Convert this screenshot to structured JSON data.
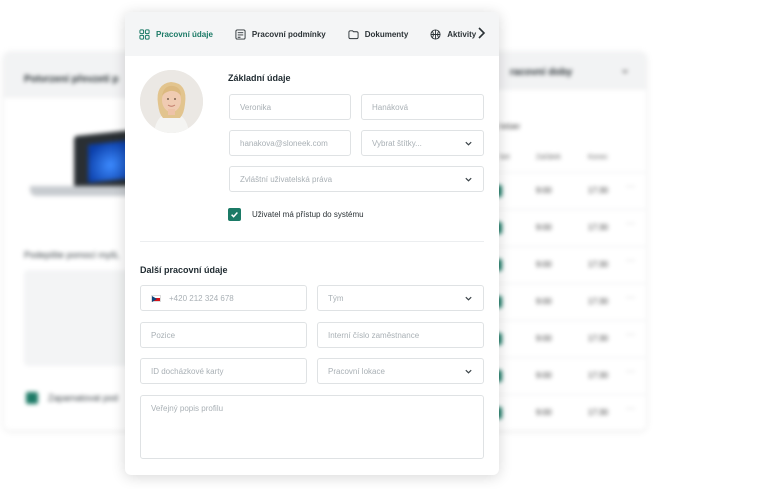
{
  "background": {
    "left_panel": {
      "title": "Potvrzení převzetí p",
      "sign_text": "Podepište pomocí myši, ",
      "remember_label": "Zapamatovat pod"
    },
    "right_panel": {
      "title": "racovní doby",
      "subtitle": "y letiær",
      "columns": [
        "bet",
        "Začátek",
        "Konec"
      ],
      "rows": [
        {
          "start": "9:00",
          "end": "17:30"
        },
        {
          "start": "9:00",
          "end": "17:30"
        },
        {
          "start": "9:00",
          "end": "17:30"
        },
        {
          "start": "9:00",
          "end": "17:30"
        },
        {
          "start": "9:00",
          "end": "17:30"
        },
        {
          "start": "9:00",
          "end": "17:30"
        },
        {
          "start": "9:00",
          "end": "17:30"
        }
      ]
    }
  },
  "tabs": [
    {
      "label": "Pracovní údaje",
      "icon": "grid-icon",
      "active": true
    },
    {
      "label": "Pracovní podmínky",
      "icon": "document-list-icon",
      "active": false
    },
    {
      "label": "Dokumenty",
      "icon": "folder-icon",
      "active": false
    },
    {
      "label": "Aktivity",
      "icon": "basketball-icon",
      "active": false
    }
  ],
  "basic": {
    "title": "Základní údaje",
    "first_name": "Veronika",
    "last_name": "Hanáková",
    "email": "hanakova@sloneek.com",
    "tags_placeholder": "Vybrat štítky...",
    "rights_placeholder": "Zvláštní uživatelská práva",
    "system_access_label": "Uživatel má přístup do systému",
    "system_access_checked": true
  },
  "work": {
    "title": "Další pracovní údaje",
    "phone": "+420 212 324 678",
    "team_placeholder": "Tým",
    "position_placeholder": "Pozice",
    "employee_number_placeholder": "Interní číslo zaměstnance",
    "attendance_card_placeholder": "ID docházkové karty",
    "location_placeholder": "Pracovní lokace",
    "profile_description_placeholder": "Veřejný popis profilu"
  },
  "colors": {
    "accent": "#1b7a66",
    "border": "#dfe2e4",
    "placeholder": "#a9b0b5"
  }
}
